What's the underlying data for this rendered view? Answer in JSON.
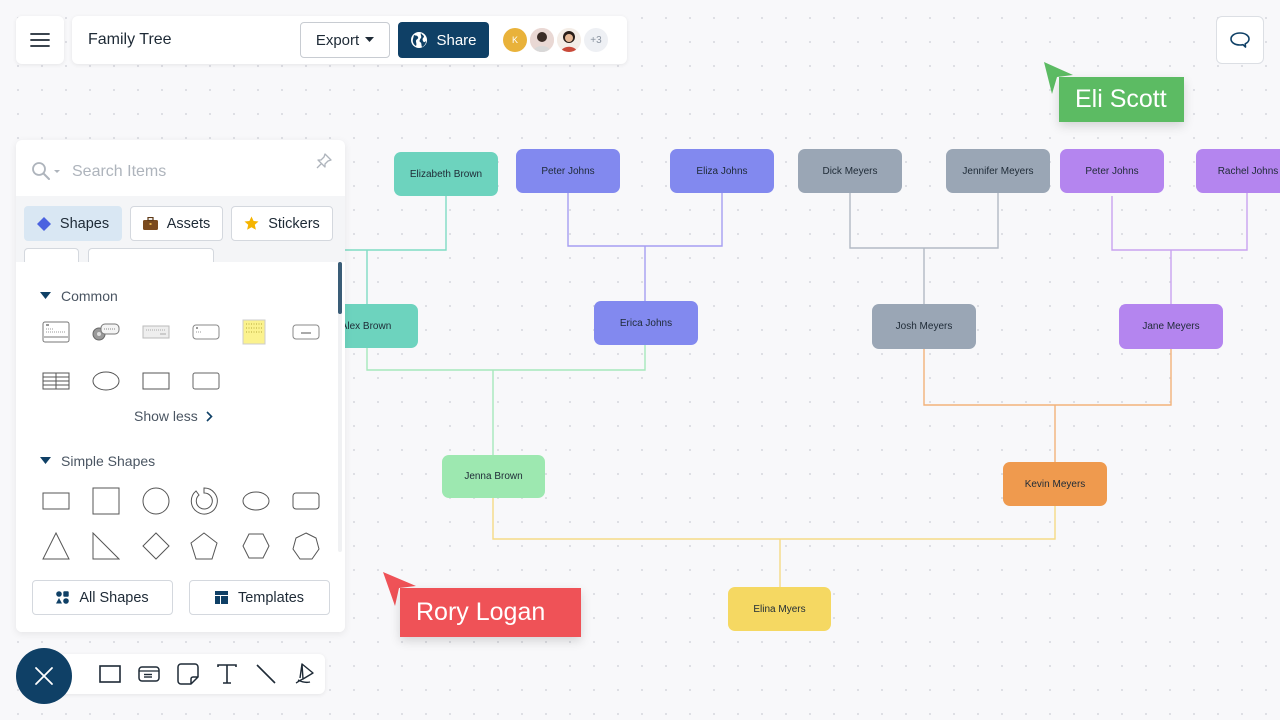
{
  "header": {
    "menu_icon": "hamburger-icon",
    "title": "Family Tree",
    "export_label": "Export",
    "share_label": "Share",
    "share_icon": "globe-icon",
    "collaborators": [
      {
        "initial": "K",
        "color": "#e9b23a"
      },
      {
        "initial": "",
        "kind": "photo"
      },
      {
        "initial": "",
        "kind": "photo"
      }
    ],
    "more_collaborators": "+3",
    "comment_icon": "comment-icon"
  },
  "panel": {
    "search_placeholder": "Search Items",
    "tabs": [
      {
        "label": "Shapes",
        "icon": "diamond-icon",
        "active": true
      },
      {
        "label": "Assets",
        "icon": "briefcase-icon",
        "active": false
      },
      {
        "label": "Stickers",
        "icon": "star-icon",
        "active": false
      }
    ],
    "sections": [
      {
        "title": "Common",
        "expanded": true,
        "shapes": [
          "card-shape",
          "callout-shape",
          "keyboard-shape",
          "label-shape",
          "sticky-note-shape",
          "button-shape",
          "table-shape",
          "ellipse-shape",
          "rectangle-shape",
          "rounded-rectangle-shape"
        ],
        "toggle_label": "Show less"
      },
      {
        "title": "Simple Shapes",
        "expanded": true,
        "shapes": [
          "rectangle",
          "square",
          "circle",
          "donut",
          "ellipse",
          "rounded-rectangle",
          "triangle",
          "right-triangle",
          "diamond",
          "pentagon",
          "hexagon",
          "heptagon"
        ]
      }
    ],
    "all_shapes_label": "All Shapes",
    "templates_label": "Templates"
  },
  "toolbar": {
    "close_icon": "close-icon",
    "tools": [
      "rectangle-tool",
      "card-tool",
      "sticky-note-tool",
      "text-tool",
      "line-tool",
      "pen-tool"
    ]
  },
  "diagram": {
    "nodes": [
      {
        "id": "elizabeth-brown",
        "label": "Elizabeth Brown",
        "color": "#6dd3be"
      },
      {
        "id": "peter-johns-1",
        "label": "Peter Johns",
        "color": "#8289ef"
      },
      {
        "id": "eliza-johns",
        "label": "Eliza Johns",
        "color": "#8289ef"
      },
      {
        "id": "dick-meyers",
        "label": "Dick Meyers",
        "color": "#9aa6b5"
      },
      {
        "id": "jennifer-meyers",
        "label": "Jennifer Meyers",
        "color": "#9aa6b5"
      },
      {
        "id": "peter-johns-2",
        "label": "Peter Johns",
        "color": "#b485ef"
      },
      {
        "id": "rachel-johns",
        "label": "Rachel Johns",
        "color": "#b485ef"
      },
      {
        "id": "alex-brown",
        "label": "Alex Brown",
        "color": "#6dd3be"
      },
      {
        "id": "erica-johns",
        "label": "Erica Johns",
        "color": "#8289ef"
      },
      {
        "id": "josh-meyers",
        "label": "Josh Meyers",
        "color": "#9aa6b5"
      },
      {
        "id": "jane-meyers",
        "label": "Jane Meyers",
        "color": "#b485ef"
      },
      {
        "id": "jenna-brown",
        "label": "Jenna Brown",
        "color": "#9de8b0"
      },
      {
        "id": "kevin-meyers",
        "label": "Kevin Meyers",
        "color": "#ef9a4e"
      },
      {
        "id": "elina-myers",
        "label": "Elina Myers",
        "color": "#f5d862"
      }
    ],
    "connector_colors": {
      "brown": "#7fdcc3",
      "johns": "#a59ef2",
      "meyers": "#b2b9c4",
      "johns2": "#c9a2f0",
      "jenna": "#a6e8bb",
      "kevin": "#f3b27a",
      "elina": "#f6da86"
    }
  },
  "cursors": [
    {
      "name": "Eli Scott",
      "color": "#5cbb63"
    },
    {
      "name": "Rory Logan",
      "color": "#ef5257"
    }
  ]
}
